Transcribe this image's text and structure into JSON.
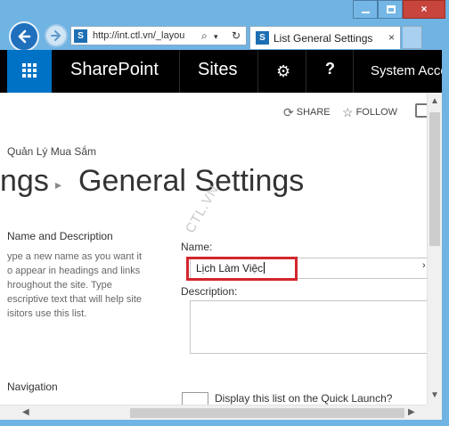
{
  "browser": {
    "url": "http://int.ctl.vn/_layou",
    "tab_title": "List General Settings",
    "tab_close": "×",
    "window_controls": {
      "close_glyph": "×"
    }
  },
  "suite_bar": {
    "brand": "SharePoint",
    "sites_label": "Sites",
    "help_label": "?",
    "account_label": "System Acco",
    "gear_glyph": "⚙"
  },
  "ribbon": {
    "share_label": "SHARE",
    "follow_label": "FOLLOW"
  },
  "page": {
    "breadcrumb": "Quản Lý Mua Sắm",
    "title_prefix": "ngs",
    "title_separator": "▸",
    "title": "General Settings",
    "watermark": "CTL.VN"
  },
  "sections": {
    "name_desc": {
      "title": "Name and Description",
      "desc_lines": [
        "ype a new name as you want it",
        "o appear in headings and links",
        "hroughout the site. Type",
        "escriptive text that will help site",
        "isitors use this list."
      ]
    },
    "navigation": {
      "title": "Navigation"
    }
  },
  "form": {
    "name_label": "Name:",
    "name_value": "Lịch Làm Việc",
    "description_label": "Description:",
    "description_value": "",
    "quick_launch_label": "Display this list on the Quick Launch?"
  },
  "colors": {
    "suite_bar": "#000000",
    "waffle": "#0072c6",
    "highlight": "#d3262d",
    "browser_frame": "#6fb4e3"
  }
}
